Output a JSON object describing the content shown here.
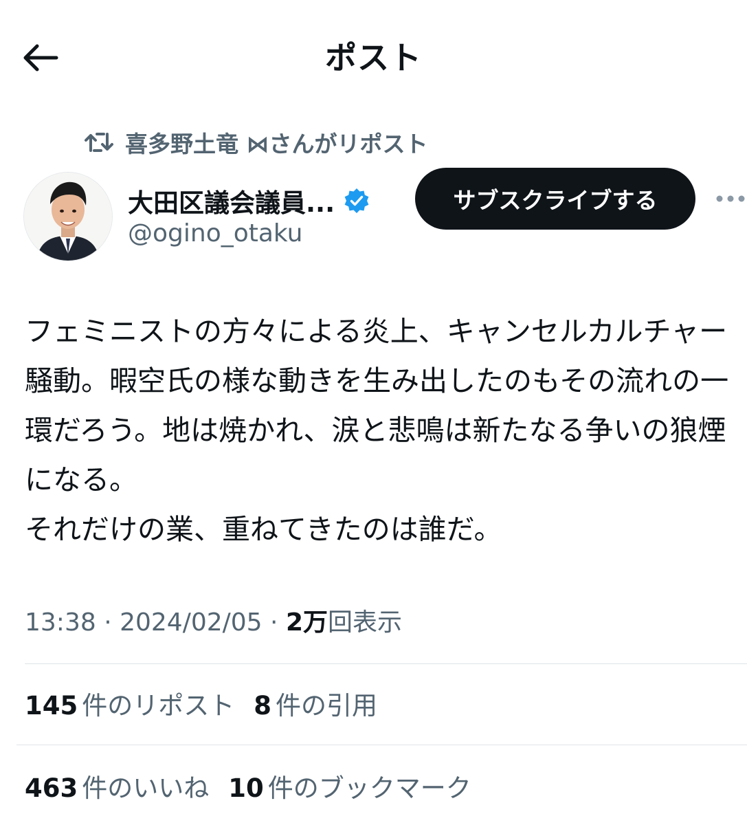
{
  "header": {
    "title": "ポスト",
    "back_icon": "arrow-left-icon"
  },
  "repost": {
    "icon": "repost-icon",
    "text": "喜多野土竜 ⋈さんがリポスト"
  },
  "author": {
    "display_name": "大田区議会議員...",
    "handle": "@ogino_otaku",
    "verified": true,
    "verified_color": "#1d9bf0"
  },
  "actions": {
    "subscribe_label": "サブスクライブする",
    "more_icon": "more-horizontal-icon"
  },
  "post": {
    "text": "フェミニストの方々による炎上、キャンセルカルチャー騒動。暇空氏の様な動きを生み出したのもその流れの一環だろう。地は焼かれ、涙と悲鳴は新たなる争いの狼煙になる。\nそれだけの業、重ねてきたのは誰だ。"
  },
  "meta": {
    "time": "13:38",
    "date": "2024/02/05",
    "views_count": "2万",
    "views_label": "回表示"
  },
  "stats": [
    {
      "count": "145",
      "label": "件のリポスト"
    },
    {
      "count": "8",
      "label": "件の引用"
    },
    {
      "count": "463",
      "label": "件のいいね"
    },
    {
      "count": "10",
      "label": "件のブックマーク"
    }
  ],
  "colors": {
    "text_primary": "#0f1419",
    "text_secondary": "#536471",
    "button_bg": "#0f1419",
    "divider": "#dfe3e6"
  }
}
